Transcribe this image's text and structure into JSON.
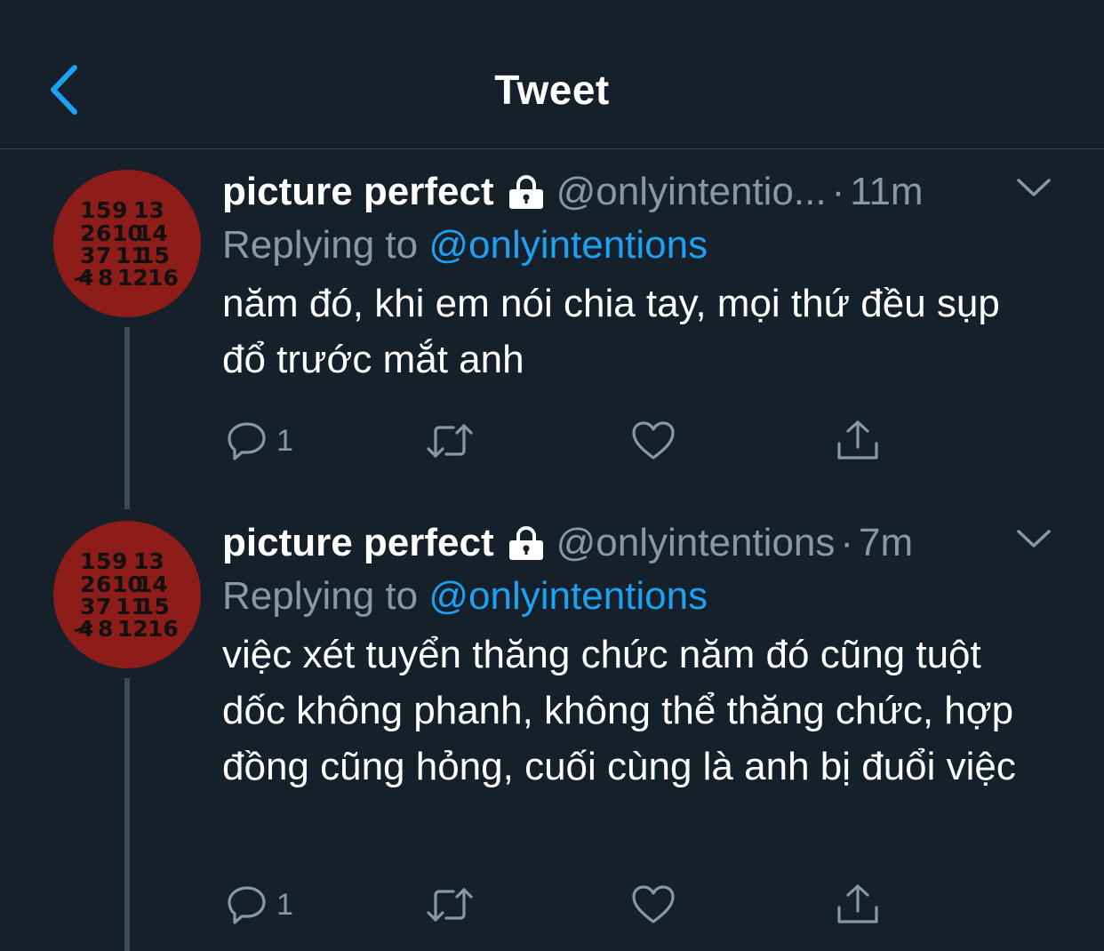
{
  "header": {
    "title": "Tweet"
  },
  "icons": {
    "back": "chevron-left-icon",
    "lock": "lock-icon",
    "caret": "chevron-down-icon",
    "reply": "comment-icon",
    "retweet": "retweet-icon",
    "like": "heart-icon",
    "share": "share-icon"
  },
  "colors": {
    "background": "#15202b",
    "accent": "#1da1f2",
    "secondary_text": "#8899a6",
    "avatar_bg": "#8e1c19"
  },
  "avatar": {
    "rows": [
      [
        "1",
        "5",
        "9",
        "13"
      ],
      [
        "2",
        "6",
        "10",
        "14"
      ],
      [
        "3",
        "7",
        "11",
        "15"
      ],
      [
        "4",
        "8",
        "12",
        "16"
      ]
    ]
  },
  "tweets": [
    {
      "name": "picture perfect",
      "handle": "@onlyintentio...",
      "separator": "·",
      "time": "11m",
      "replying_prefix": "Replying to",
      "replying_to": "@onlyintentions",
      "text": "năm đó, khi em nói chia tay, mọi thứ đều sụp đổ trước mắt anh",
      "reply_count": "1"
    },
    {
      "name": "picture perfect",
      "handle": "@onlyintentions",
      "separator": "·",
      "time": "7m",
      "replying_prefix": "Replying to",
      "replying_to": "@onlyintentions",
      "text": "việc xét tuyển thăng chức năm đó cũng tuột dốc không phanh, không thể thăng chức, hợp đồng cũng hỏng, cuối cùng là anh bị đuổi việc",
      "reply_count": "1"
    }
  ]
}
